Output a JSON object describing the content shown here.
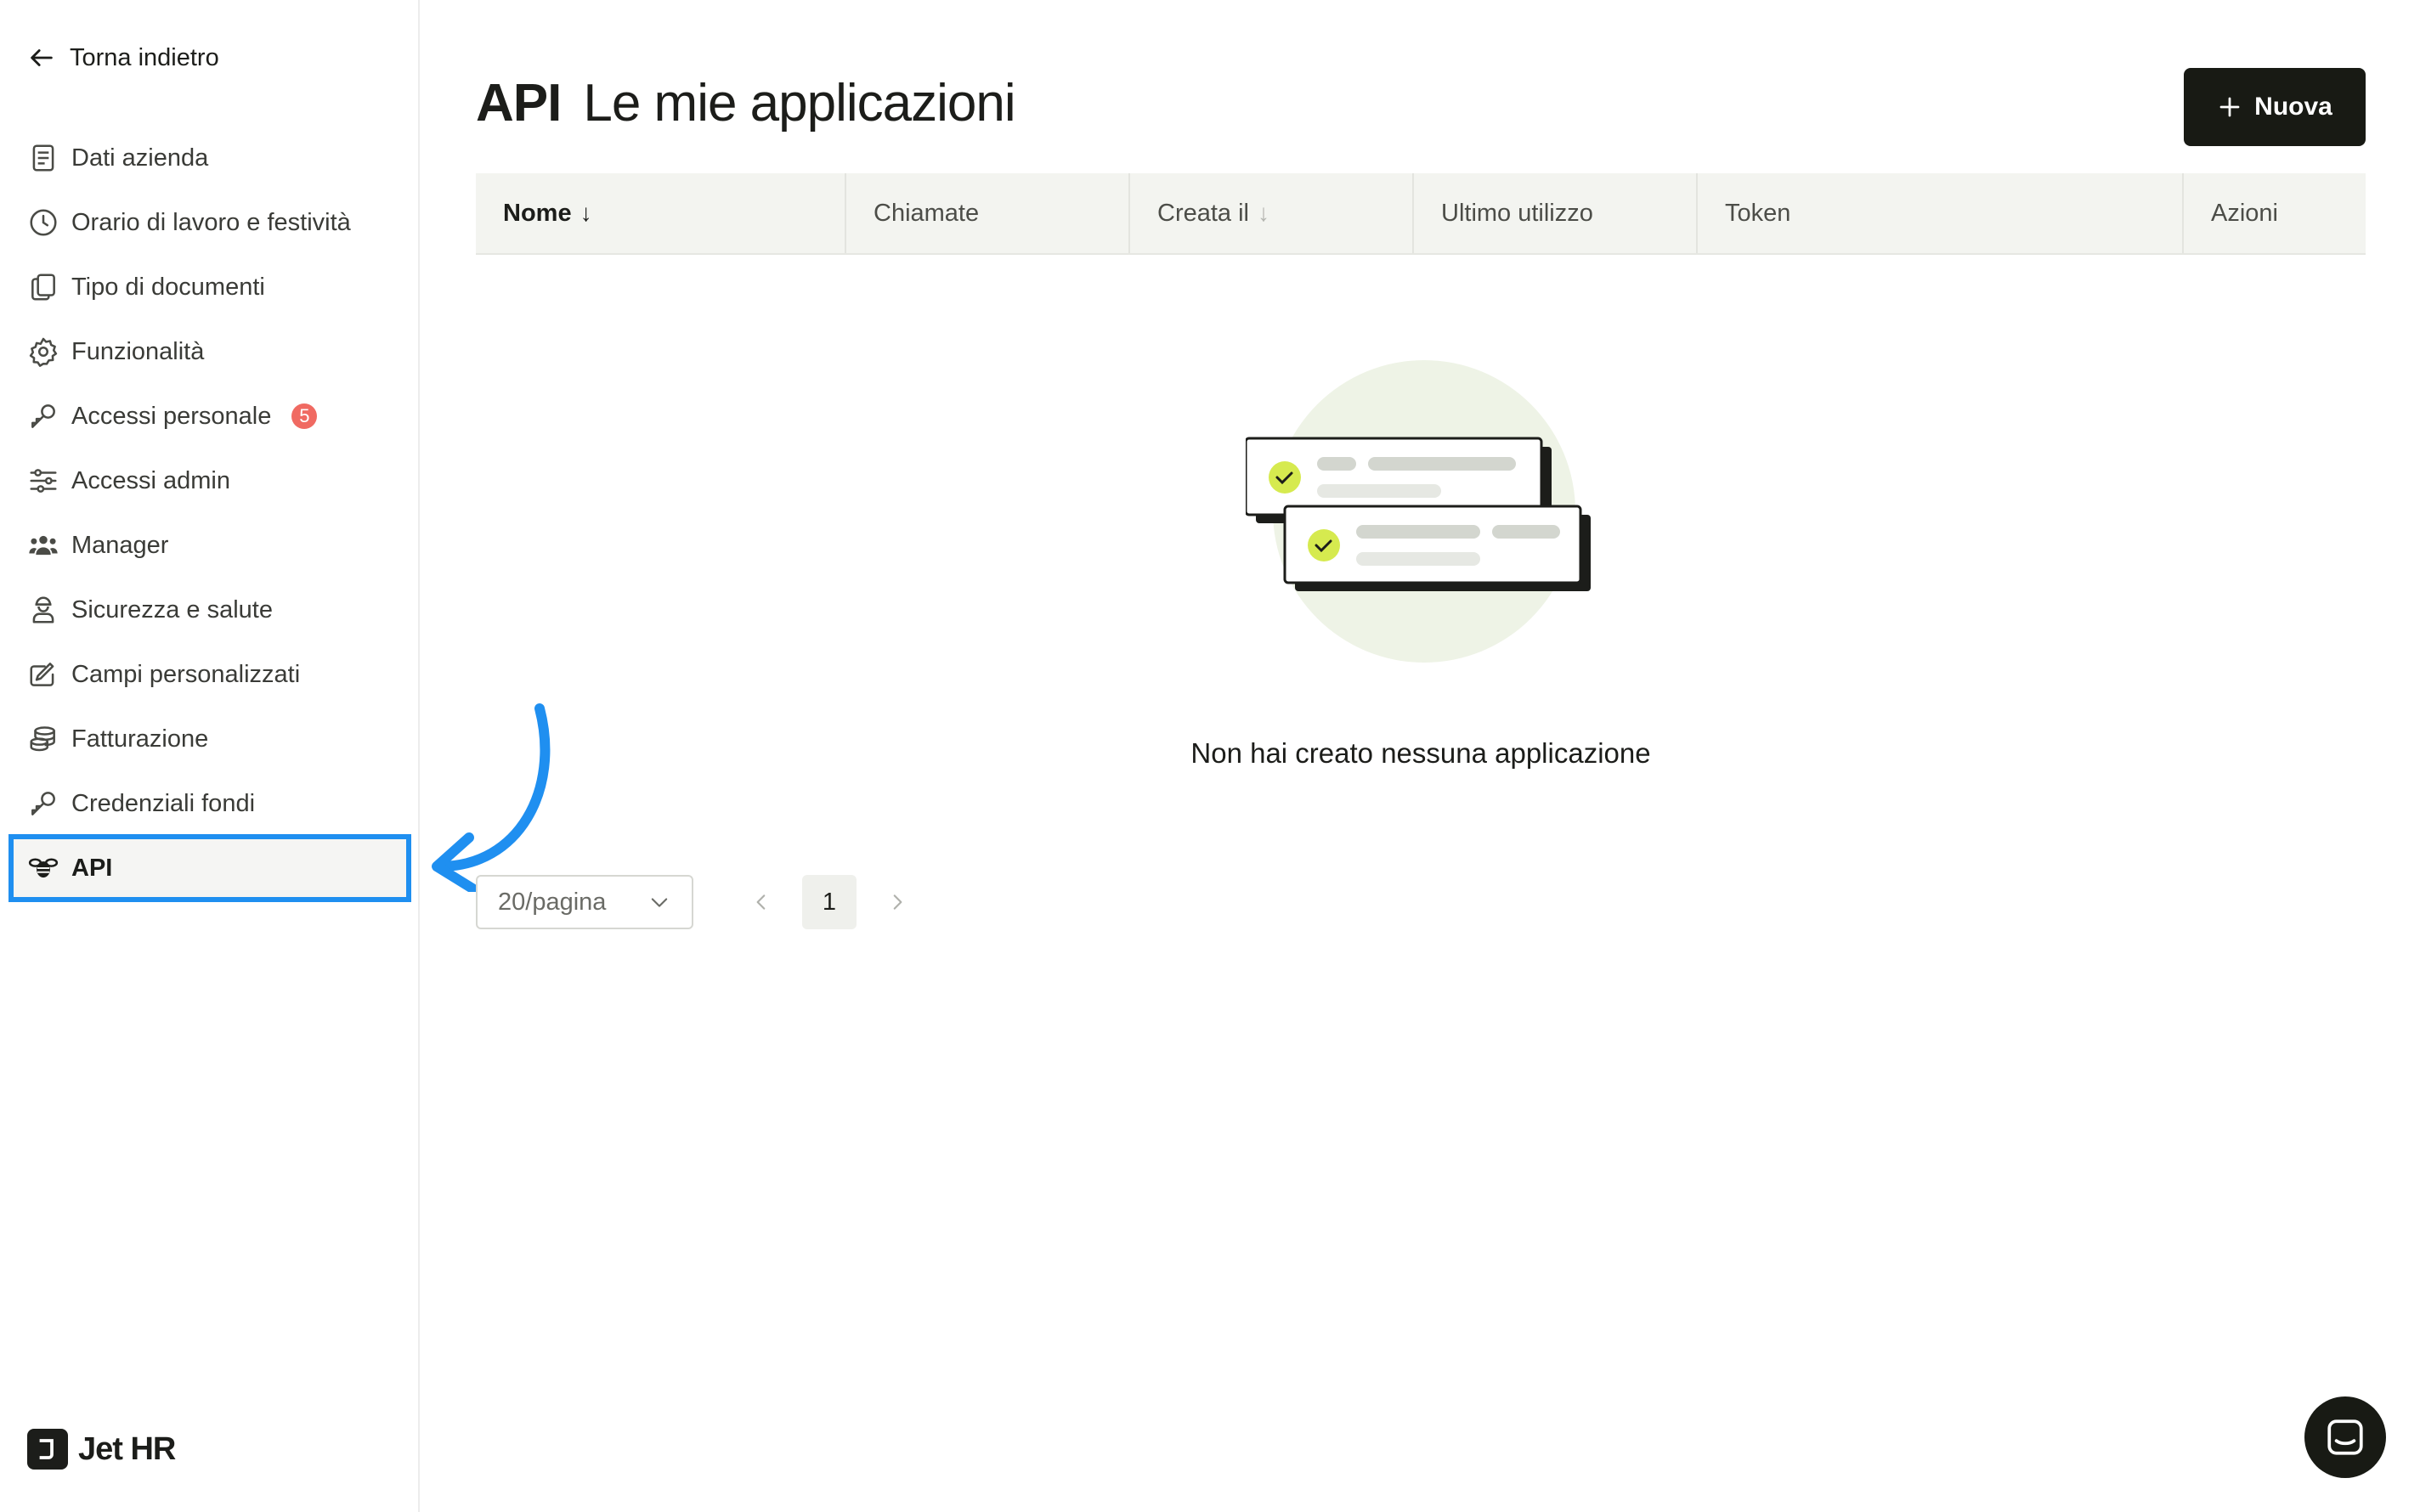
{
  "sidebar": {
    "back_label": "Torna indietro",
    "items": [
      {
        "label": "Dati azienda",
        "icon": "document-icon"
      },
      {
        "label": "Orario di lavoro e festività",
        "icon": "clock-icon"
      },
      {
        "label": "Tipo di documenti",
        "icon": "copy-documents-icon"
      },
      {
        "label": "Funzionalità",
        "icon": "gear-icon"
      },
      {
        "label": "Accessi personale",
        "icon": "key-icon",
        "badge": "5"
      },
      {
        "label": "Accessi admin",
        "icon": "sliders-icon"
      },
      {
        "label": "Manager",
        "icon": "users-icon"
      },
      {
        "label": "Sicurezza e salute",
        "icon": "worker-icon"
      },
      {
        "label": "Campi personalizzati",
        "icon": "edit-field-icon"
      },
      {
        "label": "Fatturazione",
        "icon": "coins-icon"
      },
      {
        "label": "Credenziali fondi",
        "icon": "key-icon"
      },
      {
        "label": "API",
        "icon": "bee-icon",
        "active": true
      }
    ],
    "brand": "Jet HR"
  },
  "header": {
    "title_strong": "API",
    "title_light": "Le mie applicazioni",
    "new_button": "Nuova"
  },
  "table": {
    "columns": [
      {
        "label": "Nome",
        "sort": "active-desc"
      },
      {
        "label": "Chiamate"
      },
      {
        "label": "Creata il",
        "sort": "inactive"
      },
      {
        "label": "Ultimo utilizzo"
      },
      {
        "label": "Token"
      },
      {
        "label": "Azioni"
      }
    ],
    "empty_message": "Non hai creato nessuna applicazione"
  },
  "pagination": {
    "page_size": "20/pagina",
    "current_page": "1"
  },
  "colors": {
    "accent_annotation": "#1f8ff0",
    "primary_button": "#181a14",
    "badge": "#f06a62",
    "check": "#d6ea4f"
  }
}
